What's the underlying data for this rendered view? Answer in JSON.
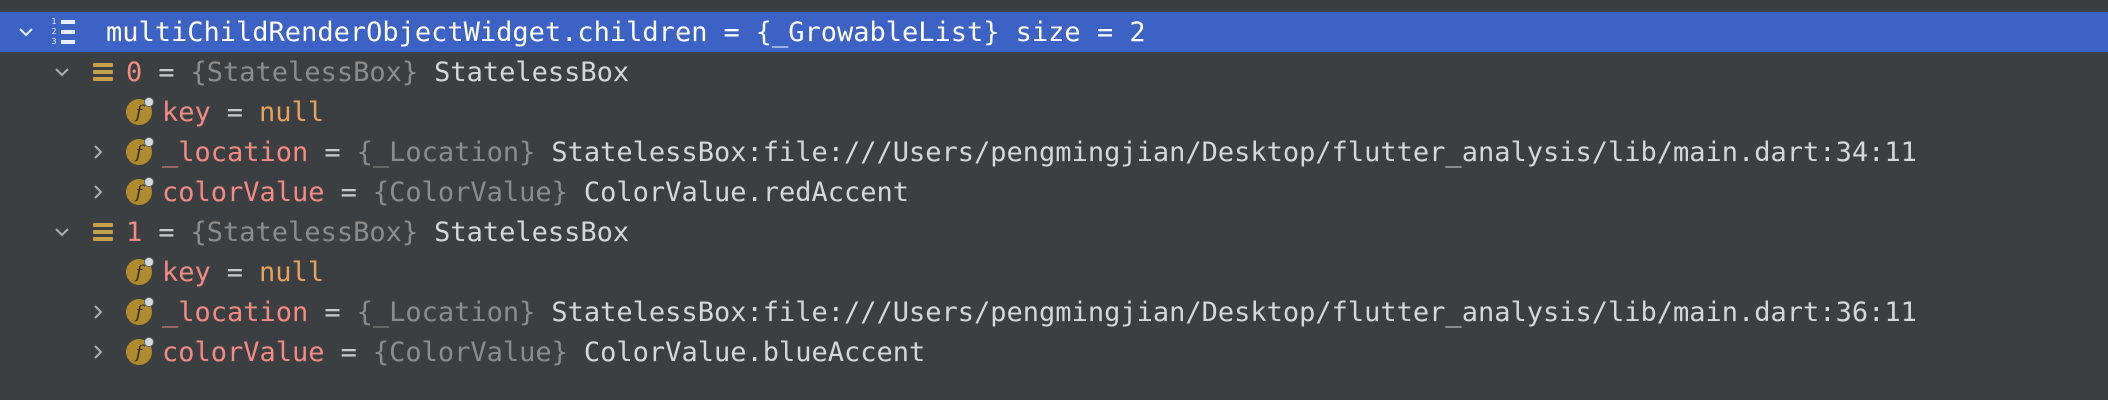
{
  "colors": {
    "background": "#3c3f41",
    "selection": "#3d62c5",
    "field_name": "#f28b82",
    "type_hint": "#8c8c8c",
    "null_keyword": "#e3a35f",
    "field_badge": "#b08a2e"
  },
  "rows": [
    {
      "name": "multiChildRenderObjectWidget.children",
      "eq": "=",
      "type": "{_GrowableList}",
      "value": "size = 2",
      "icon": "list-icon",
      "expanded": true,
      "selected": true
    },
    {
      "name": "0",
      "eq": "=",
      "type": "{StatelessBox}",
      "value": "StatelessBox",
      "icon": "array-element-icon",
      "expanded": true
    },
    {
      "name": "key",
      "eq": "=",
      "value": "null",
      "icon": "field-icon"
    },
    {
      "name": "_location",
      "eq": "=",
      "type": "{_Location}",
      "value": "StatelessBox:file:///Users/pengmingjian/Desktop/flutter_analysis/lib/main.dart:34:11",
      "icon": "field-icon",
      "expanded": false
    },
    {
      "name": "colorValue",
      "eq": "=",
      "type": "{ColorValue}",
      "value": "ColorValue.redAccent",
      "icon": "field-icon",
      "expanded": false
    },
    {
      "name": "1",
      "eq": "=",
      "type": "{StatelessBox}",
      "value": "StatelessBox",
      "icon": "array-element-icon",
      "expanded": true
    },
    {
      "name": "key",
      "eq": "=",
      "value": "null",
      "icon": "field-icon"
    },
    {
      "name": "_location",
      "eq": "=",
      "type": "{_Location}",
      "value": "StatelessBox:file:///Users/pengmingjian/Desktop/flutter_analysis/lib/main.dart:36:11",
      "icon": "field-icon",
      "expanded": false
    },
    {
      "name": "colorValue",
      "eq": "=",
      "type": "{ColorValue}",
      "value": "ColorValue.blueAccent",
      "icon": "field-icon",
      "expanded": false
    }
  ]
}
